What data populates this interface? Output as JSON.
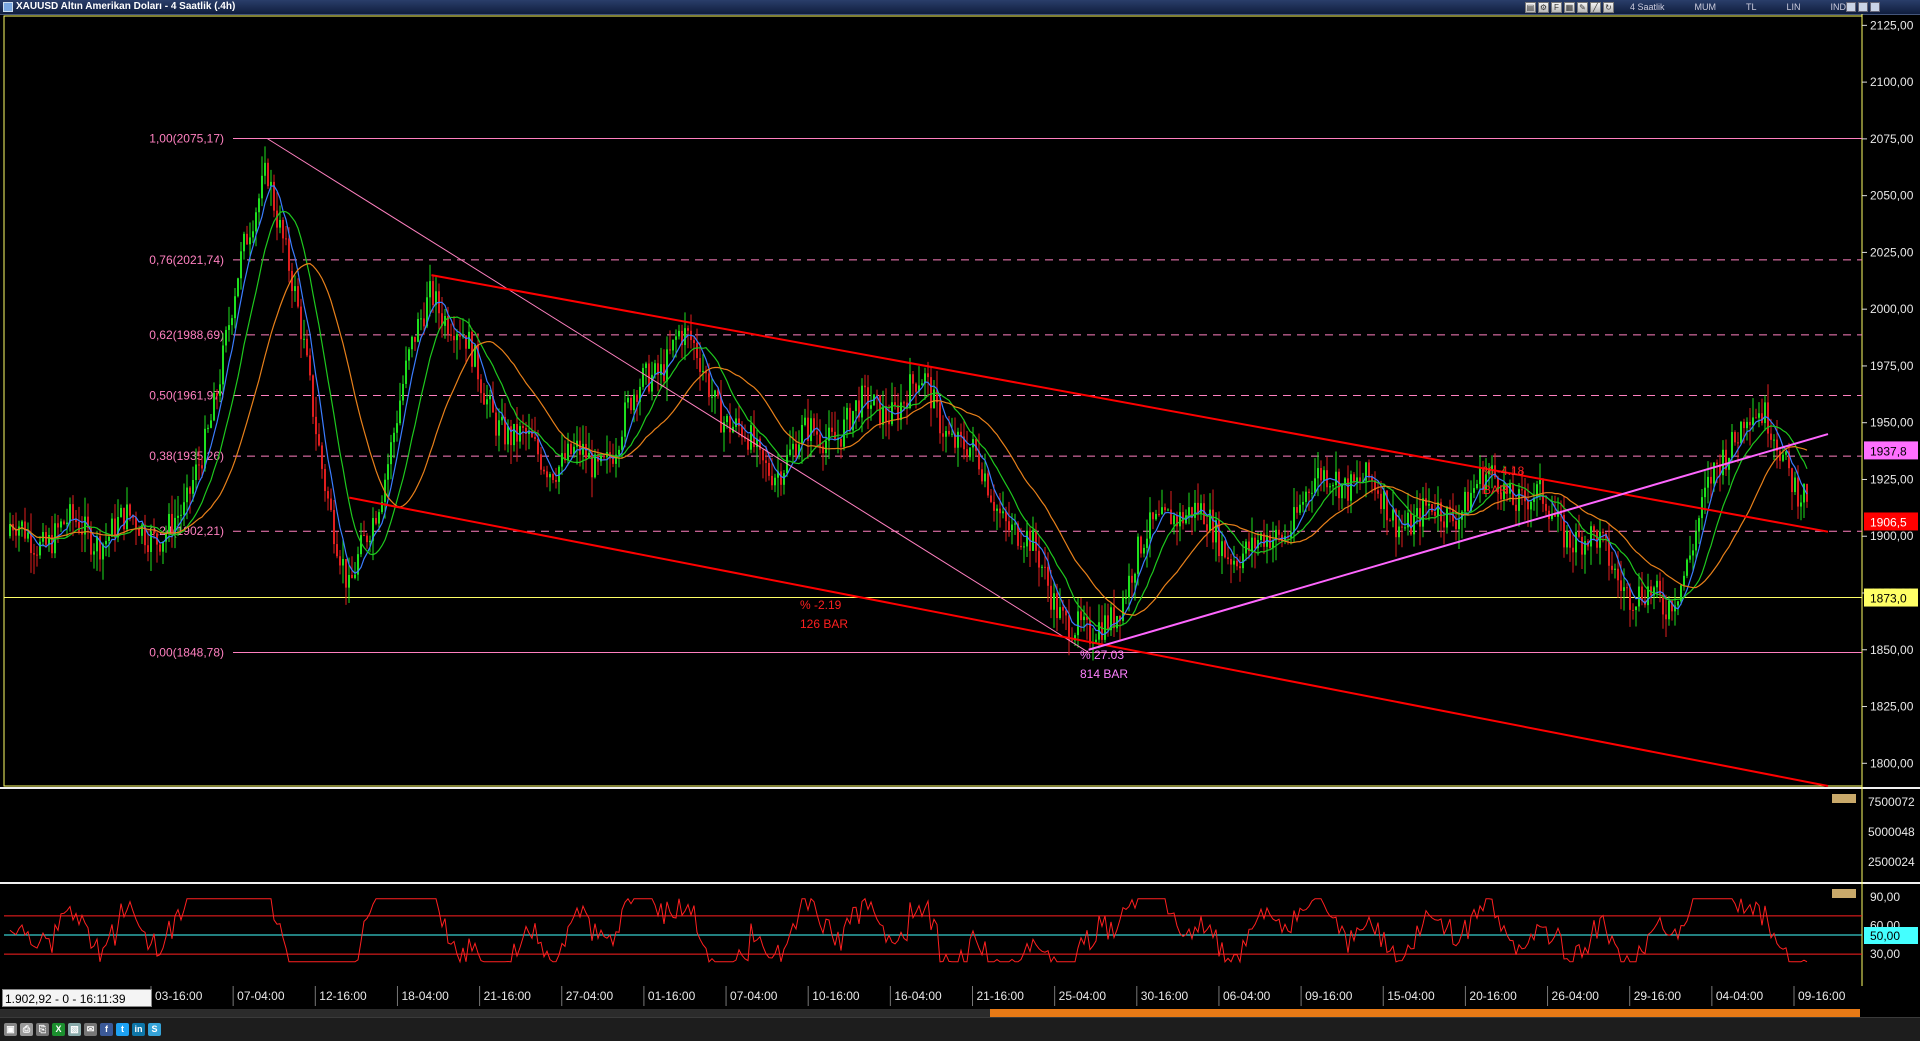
{
  "window": {
    "title": "XAUUSD Altın Amerikan Doları - 4 Saatlik (.4h)",
    "toolbar_texts": [
      "4 Saatlik",
      "MUM",
      "TL",
      "LIN",
      "IND"
    ]
  },
  "status": {
    "text": "1.902,92 - 0 - 16:11:39"
  },
  "price_axis": {
    "ticks": [
      "2125,00",
      "2100,00",
      "2075,00",
      "2050,00",
      "2025,00",
      "2000,00",
      "1975,00",
      "1950,00",
      "1925,00",
      "1900,00",
      "1875,00",
      "1850,00",
      "1825,00",
      "1800,00"
    ]
  },
  "price_markers": [
    {
      "label": "1937,8",
      "bg": "#ff6fff",
      "fg": "#000000",
      "price": 1937.8
    },
    {
      "label": "1906,5",
      "bg": "#ff0000",
      "fg": "#ffffff",
      "price": 1906.5
    },
    {
      "label": "1873,0",
      "bg": "#ffff66",
      "fg": "#000000",
      "price": 1873.0
    }
  ],
  "fibonacci": {
    "levels": [
      {
        "label": "1,00(2075,17)",
        "price": 2075.17,
        "solid": true
      },
      {
        "label": "0,76(2021,74)",
        "price": 2021.74,
        "solid": false
      },
      {
        "label": "0,62(1988,69)",
        "price": 1988.69,
        "solid": false
      },
      {
        "label": "0,50(1961,97)",
        "price": 1961.97,
        "solid": false
      },
      {
        "label": "0,38(1935,26)",
        "price": 1935.26,
        "solid": false
      },
      {
        "label": "0,24(1902,21)",
        "price": 1902.21,
        "solid": false
      },
      {
        "label": "0,00(1848,78)",
        "price": 1848.78,
        "solid": true
      }
    ],
    "color": "#ff80c0"
  },
  "horizontal_line": {
    "price": 1873.0,
    "color": "#ffff66"
  },
  "annotations": [
    {
      "line1": "% -2.19",
      "line2": "126 BAR",
      "color": "#ff2020"
    },
    {
      "line1": "% 27.03",
      "line2": "814 BAR",
      "color": "#ff80ff"
    },
    {
      "line1": "% -4.18",
      "line2": "BAR",
      "color": "#ff2020"
    }
  ],
  "volume_axis": {
    "ticks": [
      "7500072",
      "5000048",
      "2500024"
    ]
  },
  "rsi": {
    "ticks": [
      "90,00",
      "60,00",
      "30,00"
    ],
    "marker": "50,00",
    "marker_bg": "#44ffff",
    "upper_level": 70,
    "lower_level": 30
  },
  "time_axis": {
    "labels": [
      "03-16:00",
      "07-04:00",
      "12-16:00",
      "18-04:00",
      "21-16:00",
      "27-04:00",
      "01-16:00",
      "07-04:00",
      "10-16:00",
      "16-04:00",
      "21-16:00",
      "25-04:00",
      "30-16:00",
      "06-04:00",
      "09-16:00",
      "15-04:00",
      "20-16:00",
      "26-04:00",
      "29-16:00",
      "04-04:00",
      "09-16:00"
    ]
  },
  "chart_data": {
    "type": "candlestick",
    "title": "XAUUSD Altın Amerikan Doları - 4 Saatlik (.4h)",
    "ylim": [
      1790,
      2130
    ],
    "price_points": [
      {
        "x": "03-16:00",
        "y": 1905
      },
      {
        "x": "07-04:00",
        "y": 2068
      },
      {
        "x": "12-16:00",
        "y": 1870
      },
      {
        "x": "18-04:00",
        "y": 2012
      },
      {
        "x": "21-16:00",
        "y": 1940
      },
      {
        "x": "27-04:00",
        "y": 1930
      },
      {
        "x": "01-16:00",
        "y": 1990
      },
      {
        "x": "07-04:00",
        "y": 1930
      },
      {
        "x": "10-16:00",
        "y": 1950
      },
      {
        "x": "16-04:00",
        "y": 1965
      },
      {
        "x": "21-16:00",
        "y": 1910
      },
      {
        "x": "25-04:00",
        "y": 1850
      },
      {
        "x": "30-16:00",
        "y": 1915
      },
      {
        "x": "06-04:00",
        "y": 1890
      },
      {
        "x": "09-16:00",
        "y": 1930
      },
      {
        "x": "15-04:00",
        "y": 1905
      },
      {
        "x": "20-16:00",
        "y": 1925
      },
      {
        "x": "26-04:00",
        "y": 1900
      },
      {
        "x": "29-16:00",
        "y": 1865
      },
      {
        "x": "04-04:00",
        "y": 1960
      },
      {
        "x": "09-16:00",
        "y": 1906
      }
    ],
    "ma_colors": [
      "#3b7dff",
      "#1ec81e",
      "#e8801a"
    ],
    "trendlines": [
      {
        "from": {
          "x": "07-04:00",
          "y": 2075.17
        },
        "to": {
          "x": "25-04:00",
          "y": 1848.78
        },
        "color": "#ff80c0"
      },
      {
        "from": {
          "x": "18-04:00",
          "y": 2015
        },
        "to": {
          "x": "09-16:00",
          "y": 1902
        },
        "color": "#ff0000"
      },
      {
        "from": {
          "x": "12-16:00",
          "y": 1917
        },
        "to": {
          "x": "09-16:00",
          "y": 1790
        },
        "color": "#ff0000"
      },
      {
        "from": {
          "x": "25-04:00",
          "y": 1850
        },
        "to": {
          "x": "09-16:00",
          "y": 1945
        },
        "color": "#ff66ff"
      }
    ]
  }
}
